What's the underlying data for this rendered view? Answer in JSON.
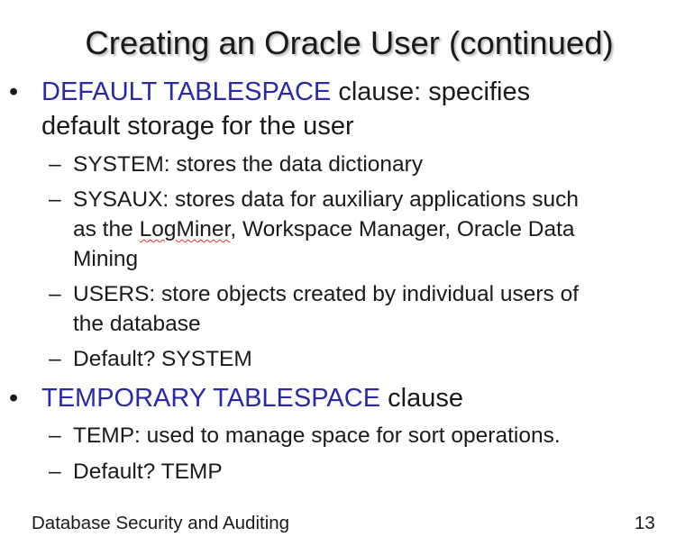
{
  "slide": {
    "title": "Creating an Oracle User (continued)",
    "bullets": [
      {
        "marker": "•",
        "keyword": "DEFAULT TABLESPACE",
        "rest_line1": " clause: specifies",
        "rest_line2": "default storage for the user",
        "subitems": [
          {
            "marker": "–",
            "text": "SYSTEM: stores the data dictionary"
          },
          {
            "marker": "–",
            "line1": "SYSAUX: stores data for auxiliary applications such",
            "line2a": "as the ",
            "line2_flagged": "LogMiner",
            "line2b": ", Workspace Manager, Oracle Data",
            "line3": "Mining"
          },
          {
            "marker": "–",
            "line1": "USERS: store objects created by individual users of",
            "line2": "the database"
          },
          {
            "marker": "–",
            "text": "Default? SYSTEM"
          }
        ]
      },
      {
        "marker": "•",
        "keyword": "TEMPORARY TABLESPACE",
        "rest": " clause",
        "subitems": [
          {
            "marker": "–",
            "text": "TEMP: used to manage space for sort operations."
          },
          {
            "marker": "–",
            "text": "Default? TEMP"
          }
        ]
      }
    ]
  },
  "footer": {
    "course": "Database Security and Auditing",
    "page_number": "13"
  },
  "colors": {
    "keyword": "#2a2aa8",
    "text": "#1a1a1a",
    "spellcheck_underline": "#d33"
  }
}
